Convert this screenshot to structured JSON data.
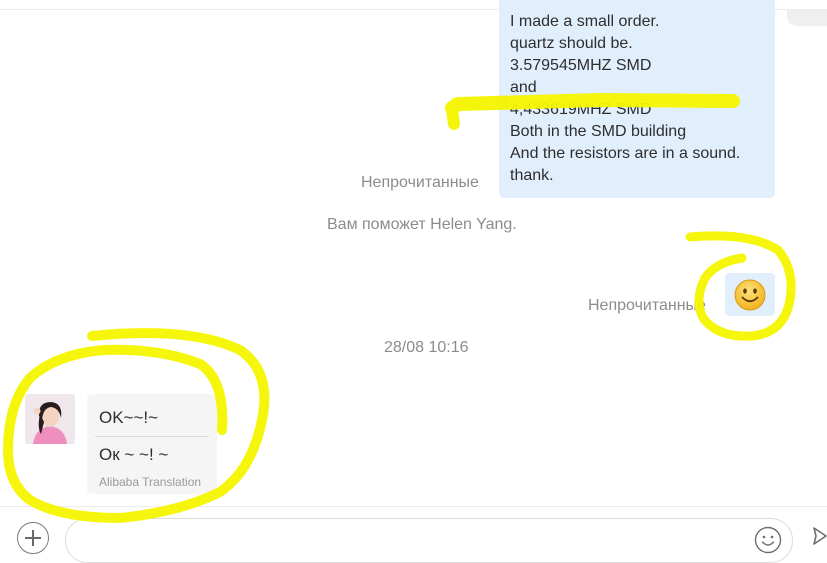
{
  "outgoing_message": {
    "lines": [
      "I made a small order.",
      "quartz should be.",
      "3.579545MHZ SMD",
      "and",
      "4,433619MHZ SMD",
      "Both in the SMD building",
      "And the resistors are in a sound.",
      "thank."
    ],
    "status": "Непрочитанные"
  },
  "system_notice": "Вам поможет Helen Yang.",
  "emoji_message": {
    "icon": "smiley-emoji-icon",
    "status": "Непрочитанные"
  },
  "timestamp": "28/08 10:16",
  "incoming_message": {
    "original": "OK~~!~",
    "translation": "Ок ~ ~! ~",
    "translation_source": "Alibaba Translation"
  },
  "composer": {
    "add_icon": "plus-circle-icon",
    "emoji_icon": "smiley-icon",
    "send_icon": "send-icon"
  },
  "colors": {
    "outgoing_bubble": "#e1eefc",
    "incoming_bubble": "#f5f5f5",
    "highlight": "#f5f500",
    "muted_text": "#8c8c8c"
  }
}
